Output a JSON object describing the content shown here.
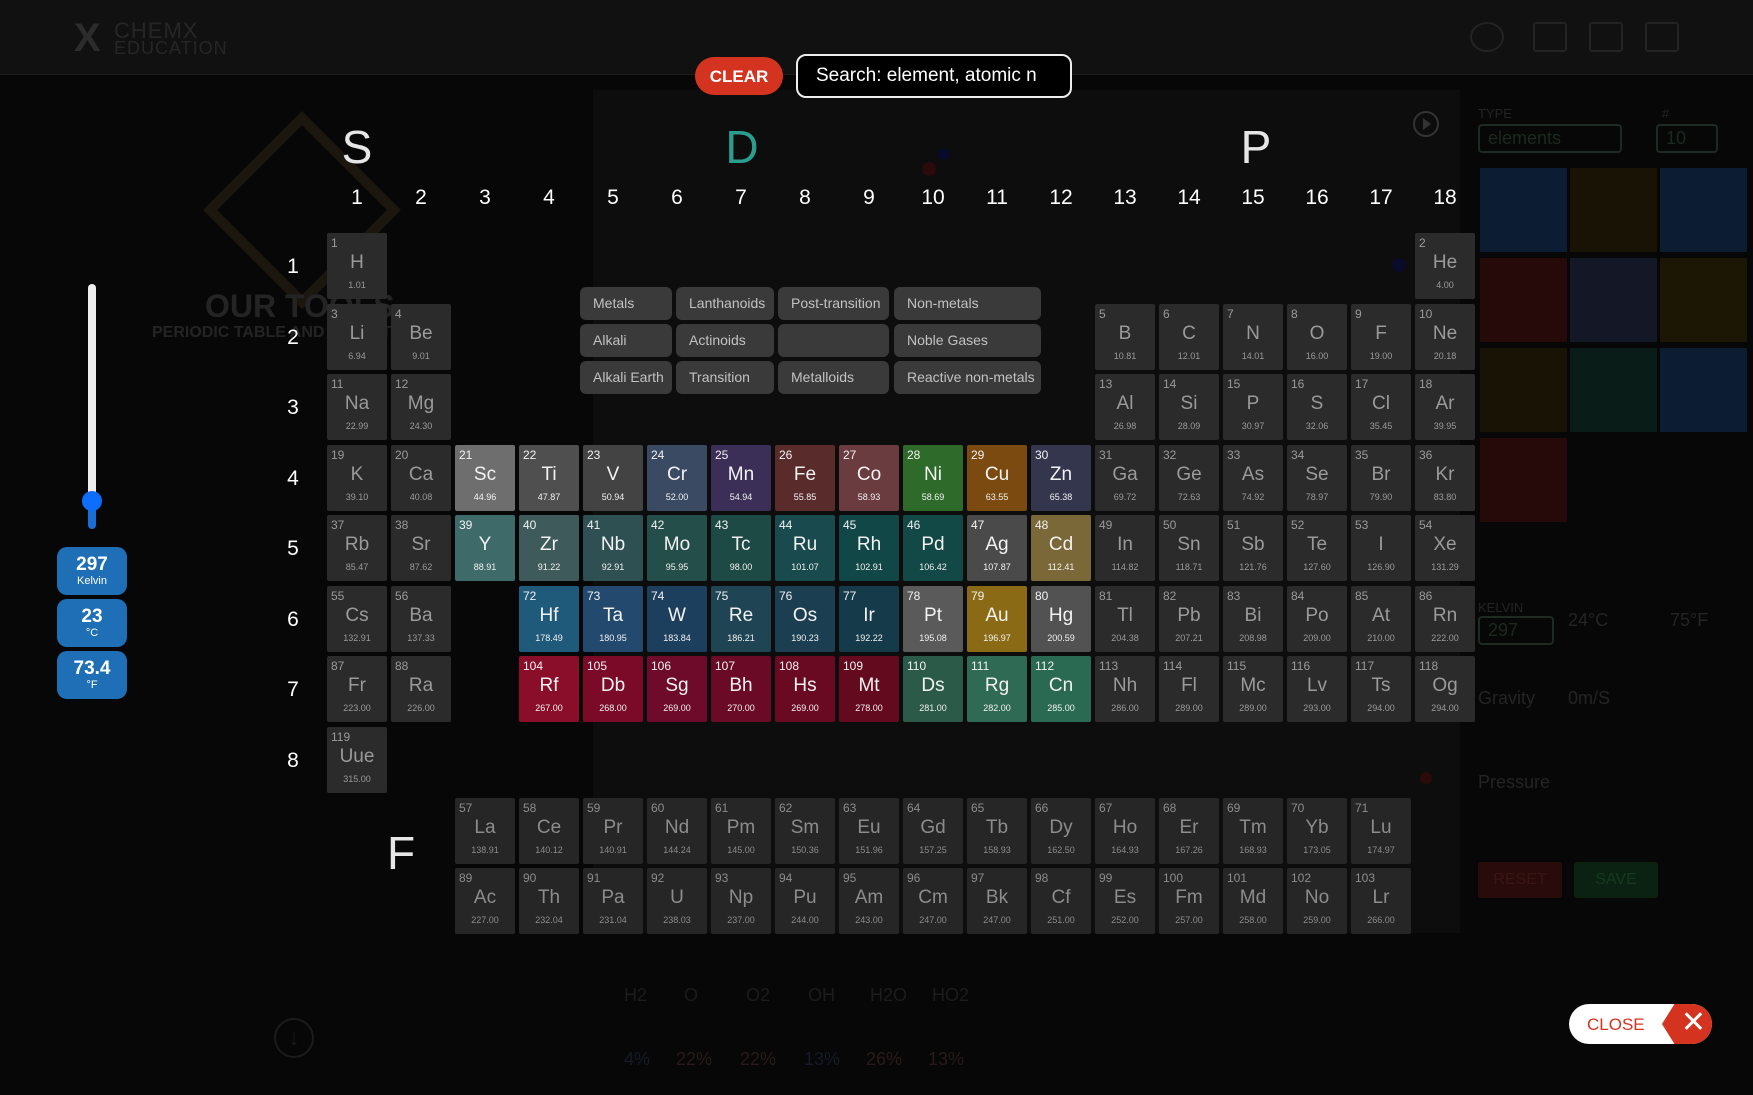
{
  "header": {
    "logo_line1": "CHEMX",
    "logo_line2": "EDUCATION"
  },
  "search": {
    "clear_label": "CLEAR",
    "placeholder": "Search: element, atomic n"
  },
  "background": {
    "tools_title": "OUR TOOLS",
    "tools_subtitle": "PERIODIC TABLE AND DEFINITIONS",
    "type_label": "TYPE",
    "type_value": "elements",
    "count_label": "#",
    "count_value": "10",
    "kelvin_label": "KELVIN",
    "kelvin_value": "297",
    "celsius_value": "24°C",
    "fahrenheit_value": "75°F",
    "gravity_label": "Gravity",
    "gravity_value": "0m/S",
    "pressure_label": "Pressure",
    "reset_label": "RESET",
    "save_label": "SAVE",
    "bottom_labels": [
      "H2",
      "O",
      "O2",
      "OH",
      "H2O",
      "HO2"
    ],
    "bottom_values": [
      "4%",
      "22%",
      "22%",
      "13%",
      "26%",
      "13%"
    ]
  },
  "blocks": {
    "s": "S",
    "d": "D",
    "p": "P",
    "f": "F"
  },
  "groups": [
    "1",
    "2",
    "3",
    "4",
    "5",
    "6",
    "7",
    "8",
    "9",
    "10",
    "11",
    "12",
    "13",
    "14",
    "15",
    "16",
    "17",
    "18"
  ],
  "periods": [
    "1",
    "2",
    "3",
    "4",
    "5",
    "6",
    "7",
    "8"
  ],
  "categories": [
    {
      "label": "Metals"
    },
    {
      "label": "Lanthanoids"
    },
    {
      "label": "Post-transition"
    },
    {
      "label": "Non-metals"
    },
    {
      "label": "Alkali"
    },
    {
      "label": "Actinoids"
    },
    {
      "label": ""
    },
    {
      "label": "Noble Gases"
    },
    {
      "label": "Alkali Earth"
    },
    {
      "label": "Transition"
    },
    {
      "label": "Metalloids"
    },
    {
      "label": "Reactive non-metals"
    }
  ],
  "elements": [
    {
      "n": "1",
      "s": "H",
      "m": "1.01"
    },
    {
      "n": "2",
      "s": "He",
      "m": "4.00"
    },
    {
      "n": "3",
      "s": "Li",
      "m": "6.94"
    },
    {
      "n": "4",
      "s": "Be",
      "m": "9.01"
    },
    {
      "n": "5",
      "s": "B",
      "m": "10.81"
    },
    {
      "n": "6",
      "s": "C",
      "m": "12.01"
    },
    {
      "n": "7",
      "s": "N",
      "m": "14.01"
    },
    {
      "n": "8",
      "s": "O",
      "m": "16.00"
    },
    {
      "n": "9",
      "s": "F",
      "m": "19.00"
    },
    {
      "n": "10",
      "s": "Ne",
      "m": "20.18"
    },
    {
      "n": "11",
      "s": "Na",
      "m": "22.99"
    },
    {
      "n": "12",
      "s": "Mg",
      "m": "24.30"
    },
    {
      "n": "13",
      "s": "Al",
      "m": "26.98"
    },
    {
      "n": "14",
      "s": "Si",
      "m": "28.09"
    },
    {
      "n": "15",
      "s": "P",
      "m": "30.97"
    },
    {
      "n": "16",
      "s": "S",
      "m": "32.06"
    },
    {
      "n": "17",
      "s": "Cl",
      "m": "35.45"
    },
    {
      "n": "18",
      "s": "Ar",
      "m": "39.95"
    },
    {
      "n": "19",
      "s": "K",
      "m": "39.10"
    },
    {
      "n": "20",
      "s": "Ca",
      "m": "40.08"
    },
    {
      "n": "21",
      "s": "Sc",
      "m": "44.96"
    },
    {
      "n": "22",
      "s": "Ti",
      "m": "47.87"
    },
    {
      "n": "23",
      "s": "V",
      "m": "50.94"
    },
    {
      "n": "24",
      "s": "Cr",
      "m": "52.00"
    },
    {
      "n": "25",
      "s": "Mn",
      "m": "54.94"
    },
    {
      "n": "26",
      "s": "Fe",
      "m": "55.85"
    },
    {
      "n": "27",
      "s": "Co",
      "m": "58.93"
    },
    {
      "n": "28",
      "s": "Ni",
      "m": "58.69"
    },
    {
      "n": "29",
      "s": "Cu",
      "m": "63.55"
    },
    {
      "n": "30",
      "s": "Zn",
      "m": "65.38"
    },
    {
      "n": "31",
      "s": "Ga",
      "m": "69.72"
    },
    {
      "n": "32",
      "s": "Ge",
      "m": "72.63"
    },
    {
      "n": "33",
      "s": "As",
      "m": "74.92"
    },
    {
      "n": "34",
      "s": "Se",
      "m": "78.97"
    },
    {
      "n": "35",
      "s": "Br",
      "m": "79.90"
    },
    {
      "n": "36",
      "s": "Kr",
      "m": "83.80"
    },
    {
      "n": "37",
      "s": "Rb",
      "m": "85.47"
    },
    {
      "n": "38",
      "s": "Sr",
      "m": "87.62"
    },
    {
      "n": "39",
      "s": "Y",
      "m": "88.91"
    },
    {
      "n": "40",
      "s": "Zr",
      "m": "91.22"
    },
    {
      "n": "41",
      "s": "Nb",
      "m": "92.91"
    },
    {
      "n": "42",
      "s": "Mo",
      "m": "95.95"
    },
    {
      "n": "43",
      "s": "Tc",
      "m": "98.00"
    },
    {
      "n": "44",
      "s": "Ru",
      "m": "101.07"
    },
    {
      "n": "45",
      "s": "Rh",
      "m": "102.91"
    },
    {
      "n": "46",
      "s": "Pd",
      "m": "106.42"
    },
    {
      "n": "47",
      "s": "Ag",
      "m": "107.87"
    },
    {
      "n": "48",
      "s": "Cd",
      "m": "112.41"
    },
    {
      "n": "49",
      "s": "In",
      "m": "114.82"
    },
    {
      "n": "50",
      "s": "Sn",
      "m": "118.71"
    },
    {
      "n": "51",
      "s": "Sb",
      "m": "121.76"
    },
    {
      "n": "52",
      "s": "Te",
      "m": "127.60"
    },
    {
      "n": "53",
      "s": "I",
      "m": "126.90"
    },
    {
      "n": "54",
      "s": "Xe",
      "m": "131.29"
    },
    {
      "n": "55",
      "s": "Cs",
      "m": "132.91"
    },
    {
      "n": "56",
      "s": "Ba",
      "m": "137.33"
    },
    {
      "n": "72",
      "s": "Hf",
      "m": "178.49"
    },
    {
      "n": "73",
      "s": "Ta",
      "m": "180.95"
    },
    {
      "n": "74",
      "s": "W",
      "m": "183.84"
    },
    {
      "n": "75",
      "s": "Re",
      "m": "186.21"
    },
    {
      "n": "76",
      "s": "Os",
      "m": "190.23"
    },
    {
      "n": "77",
      "s": "Ir",
      "m": "192.22"
    },
    {
      "n": "78",
      "s": "Pt",
      "m": "195.08"
    },
    {
      "n": "79",
      "s": "Au",
      "m": "196.97"
    },
    {
      "n": "80",
      "s": "Hg",
      "m": "200.59"
    },
    {
      "n": "81",
      "s": "Tl",
      "m": "204.38"
    },
    {
      "n": "82",
      "s": "Pb",
      "m": "207.21"
    },
    {
      "n": "83",
      "s": "Bi",
      "m": "208.98"
    },
    {
      "n": "84",
      "s": "Po",
      "m": "209.00"
    },
    {
      "n": "85",
      "s": "At",
      "m": "210.00"
    },
    {
      "n": "86",
      "s": "Rn",
      "m": "222.00"
    },
    {
      "n": "87",
      "s": "Fr",
      "m": "223.00"
    },
    {
      "n": "88",
      "s": "Ra",
      "m": "226.00"
    },
    {
      "n": "104",
      "s": "Rf",
      "m": "267.00"
    },
    {
      "n": "105",
      "s": "Db",
      "m": "268.00"
    },
    {
      "n": "106",
      "s": "Sg",
      "m": "269.00"
    },
    {
      "n": "107",
      "s": "Bh",
      "m": "270.00"
    },
    {
      "n": "108",
      "s": "Hs",
      "m": "269.00"
    },
    {
      "n": "109",
      "s": "Mt",
      "m": "278.00"
    },
    {
      "n": "110",
      "s": "Ds",
      "m": "281.00"
    },
    {
      "n": "111",
      "s": "Rg",
      "m": "282.00"
    },
    {
      "n": "112",
      "s": "Cn",
      "m": "285.00"
    },
    {
      "n": "113",
      "s": "Nh",
      "m": "286.00"
    },
    {
      "n": "114",
      "s": "Fl",
      "m": "289.00"
    },
    {
      "n": "115",
      "s": "Mc",
      "m": "289.00"
    },
    {
      "n": "116",
      "s": "Lv",
      "m": "293.00"
    },
    {
      "n": "117",
      "s": "Ts",
      "m": "294.00"
    },
    {
      "n": "118",
      "s": "Og",
      "m": "294.00"
    },
    {
      "n": "119",
      "s": "Uue",
      "m": "315.00"
    },
    {
      "n": "57",
      "s": "La",
      "m": "138.91"
    },
    {
      "n": "58",
      "s": "Ce",
      "m": "140.12"
    },
    {
      "n": "59",
      "s": "Pr",
      "m": "140.91"
    },
    {
      "n": "60",
      "s": "Nd",
      "m": "144.24"
    },
    {
      "n": "61",
      "s": "Pm",
      "m": "145.00"
    },
    {
      "n": "62",
      "s": "Sm",
      "m": "150.36"
    },
    {
      "n": "63",
      "s": "Eu",
      "m": "151.96"
    },
    {
      "n": "64",
      "s": "Gd",
      "m": "157.25"
    },
    {
      "n": "65",
      "s": "Tb",
      "m": "158.93"
    },
    {
      "n": "66",
      "s": "Dy",
      "m": "162.50"
    },
    {
      "n": "67",
      "s": "Ho",
      "m": "164.93"
    },
    {
      "n": "68",
      "s": "Er",
      "m": "167.26"
    },
    {
      "n": "69",
      "s": "Tm",
      "m": "168.93"
    },
    {
      "n": "70",
      "s": "Yb",
      "m": "173.05"
    },
    {
      "n": "71",
      "s": "Lu",
      "m": "174.97"
    },
    {
      "n": "89",
      "s": "Ac",
      "m": "227.00"
    },
    {
      "n": "90",
      "s": "Th",
      "m": "232.04"
    },
    {
      "n": "91",
      "s": "Pa",
      "m": "231.04"
    },
    {
      "n": "92",
      "s": "U",
      "m": "238.03"
    },
    {
      "n": "93",
      "s": "Np",
      "m": "237.00"
    },
    {
      "n": "94",
      "s": "Pu",
      "m": "244.00"
    },
    {
      "n": "95",
      "s": "Am",
      "m": "243.00"
    },
    {
      "n": "96",
      "s": "Cm",
      "m": "247.00"
    },
    {
      "n": "97",
      "s": "Bk",
      "m": "247.00"
    },
    {
      "n": "98",
      "s": "Cf",
      "m": "251.00"
    },
    {
      "n": "99",
      "s": "Es",
      "m": "252.00"
    },
    {
      "n": "100",
      "s": "Fm",
      "m": "257.00"
    },
    {
      "n": "101",
      "s": "Md",
      "m": "258.00"
    },
    {
      "n": "102",
      "s": "No",
      "m": "259.00"
    },
    {
      "n": "103",
      "s": "Lr",
      "m": "266.00"
    }
  ],
  "temperature": {
    "kelvin_value": "297",
    "kelvin_unit": "Kelvin",
    "celsius_value": "23",
    "celsius_unit": "°C",
    "fahrenheit_value": "73.4",
    "fahrenheit_unit": "°F",
    "slider_level": 0.08
  },
  "close": {
    "label": "CLOSE",
    "icon": "close-icon"
  },
  "colors": {
    "clear": "#d4331f",
    "temperature_badge": "#1f6fb7",
    "slider_handle": "#0d6efd",
    "block_d": "#2a9d8f"
  }
}
